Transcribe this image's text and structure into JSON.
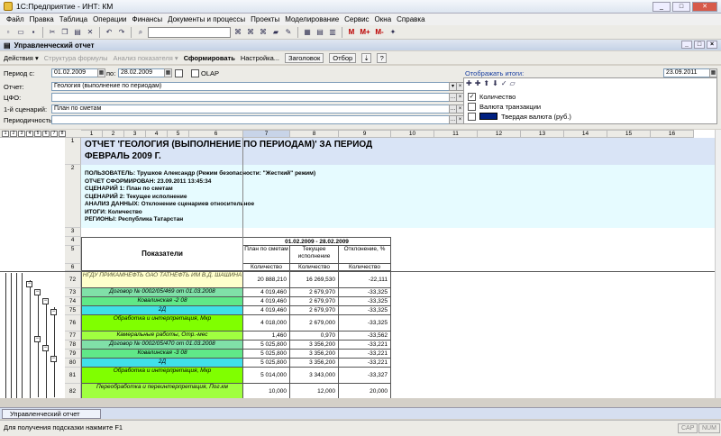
{
  "window": {
    "title": "1С:Предприятие - ИНТ: КМ",
    "min": "_",
    "max": "□",
    "close": "✕"
  },
  "menu": [
    "Файл",
    "Правка",
    "Таблица",
    "Операции",
    "Финансы",
    "Документы и процессы",
    "Проекты",
    "Моделирование",
    "Сервис",
    "Окна",
    "Справка"
  ],
  "toolbar": {
    "m": "M",
    "mplus": "M+",
    "mminus": "M-"
  },
  "doc": {
    "title": "Управленческий отчет"
  },
  "actions": {
    "actions": "Действия ▾",
    "formula": "Структура формулы",
    "analysis": "Анализ показателя ▾",
    "generate": "Сформировать",
    "settings": "Настройка...",
    "header": "Заголовок",
    "select": "Отбор",
    "help": "?"
  },
  "params": {
    "period_label": "Период с:",
    "date_from": "01.02.2009",
    "to_label": "по:",
    "date_to": "28.02.2009",
    "olap": "OLAP",
    "report_label": "Отчет:",
    "report": "Геология (выполнение по периодам)",
    "cfo_label": "ЦФО:",
    "scenario_label": "1-й сценарий:",
    "scenario": "План по сметам",
    "periodicity_label": "Периодичность:",
    "totals_label": "Отображать итоги:",
    "totals_date": "23.09.2011",
    "totals": [
      "Количество",
      "Валюта транзакции",
      "Твердая валюта (руб.)"
    ]
  },
  "grid": {
    "cols": [
      "1",
      "2",
      "3",
      "4",
      "5",
      "6",
      "7",
      "8",
      "9",
      "10",
      "11",
      "12",
      "13",
      "14",
      "15",
      "16"
    ],
    "title1": "ОТЧЕТ 'ГЕОЛОГИЯ (ВЫПОЛНЕНИЕ ПО ПЕРИОДАМ)' ЗА ПЕРИОД",
    "title2": "ФЕВРАЛЬ 2009 Г.",
    "info": [
      "ПОЛЬЗОВАТЕЛЬ: Трушков Александр (Режим безопасности: \"Жесткий\" режим)",
      "ОТЧЕТ СФОРМИРОВАН: 23.09.2011 13:45:34",
      "СЦЕНАРИЙ 1: План по сметам",
      "СЦЕНАРИЙ 2: Текущее исполнение",
      "АНАЛИЗ ДАННЫХ: Отклонение сценариев относительное",
      "ИТОГИ: Количество",
      "РЕГИОНЫ: Республика Татарстан"
    ],
    "period_hdr": "01.02.2009 - 28.02.2009",
    "ind_hdr": "Показатели",
    "h1": "План по сметам",
    "h2": "Текущее исполнение",
    "h3": "Отклонение, %",
    "qty": "Количество",
    "rows": [
      {
        "n": "72",
        "t": "НГДУ ПРИКАМНЕФТЬ ОАО ТАТНЕФТЬ ИМ В.Д. ШАШИНА",
        "a": "20 888,210",
        "b": "16 269,530",
        "c": "-22,111"
      },
      {
        "n": "73",
        "t": "Договор № 0002/05/469 от 01.03.2008",
        "a": "4 019,460",
        "b": "2 679,970",
        "c": "-33,325"
      },
      {
        "n": "74",
        "t": "Ковалинская -2 08",
        "a": "4 019,460",
        "b": "2 679,970",
        "c": "-33,325"
      },
      {
        "n": "75",
        "t": "2Д",
        "a": "4 019,460",
        "b": "2 679,970",
        "c": "-33,325"
      },
      {
        "n": "76",
        "t": "Обработка и интерпретация, Мкр",
        "a": "4 018,000",
        "b": "2 679,000",
        "c": "-33,325"
      },
      {
        "n": "77",
        "t": "Камеральные работы, Отр.-мес",
        "a": "1,460",
        "b": "0,970",
        "c": "-33,562"
      },
      {
        "n": "78",
        "t": "Договор № 0002/05/470 от 01.03.2008",
        "a": "5 025,800",
        "b": "3 356,200",
        "c": "-33,221"
      },
      {
        "n": "79",
        "t": "Ковалинская -3 08",
        "a": "5 025,800",
        "b": "3 356,200",
        "c": "-33,221"
      },
      {
        "n": "80",
        "t": "2Д",
        "a": "5 025,800",
        "b": "3 356,200",
        "c": "-33,221"
      },
      {
        "n": "81",
        "t": "Обработка и интерпретация, Мкр",
        "a": "5 014,000",
        "b": "3 343,000",
        "c": "-33,327"
      },
      {
        "n": "82",
        "t": "Переобработка и переинтерпретация, Пог.км",
        "a": "10,000",
        "b": "12,000",
        "c": "20,000"
      }
    ]
  },
  "taskbar": {
    "tab": "Управленческий отчет"
  },
  "status": {
    "hint": "Для получения подсказки нажмите F1",
    "cap": "CAP",
    "num": "NUM"
  },
  "colors": {
    "info_bg": "#e6fbff",
    "title_bg": "#d9e4f6",
    "cust_bg": "#ffffcc",
    "contract_bg": "#80e0a8",
    "field_bg": "#60e888",
    "dim_bg": "#40e0e8",
    "work_bg": "#80ff00",
    "work2_bg": "#a0ff40"
  }
}
